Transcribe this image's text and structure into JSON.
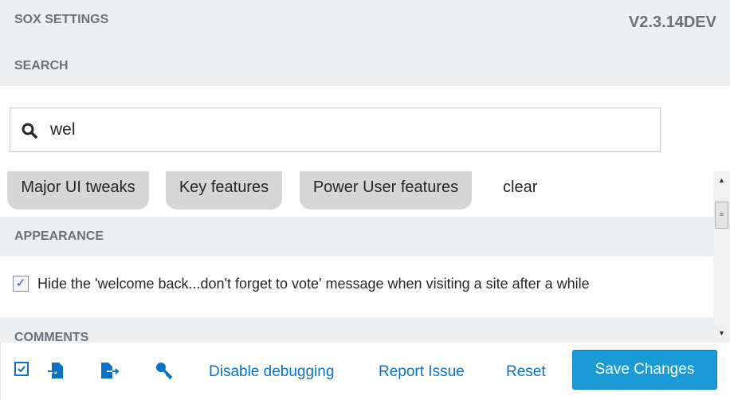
{
  "header": {
    "title": "SOX SETTINGS",
    "version": "V2.3.14DEV",
    "search_label": "SEARCH"
  },
  "search": {
    "value": "wel",
    "icon": "search-icon"
  },
  "tags": [
    {
      "label": "Major UI tweaks"
    },
    {
      "label": "Key features"
    },
    {
      "label": "Power User features"
    }
  ],
  "clear_label": "clear",
  "sections": [
    {
      "title": "APPEARANCE",
      "options": [
        {
          "label": "Hide the 'welcome back...don't forget to vote' message when visiting a site after a while",
          "checked": true
        }
      ]
    },
    {
      "title": "COMMENTS"
    }
  ],
  "footer": {
    "icons": [
      "checkbox-icon",
      "import-icon",
      "export-icon",
      "key-icon"
    ],
    "disable_debugging": "Disable debugging",
    "report_issue": "Report Issue",
    "reset": "Reset",
    "save": "Save Changes"
  },
  "colors": {
    "accent": "#1c9ad6",
    "link": "#0a72c8",
    "header_bg": "#eeeff1"
  }
}
